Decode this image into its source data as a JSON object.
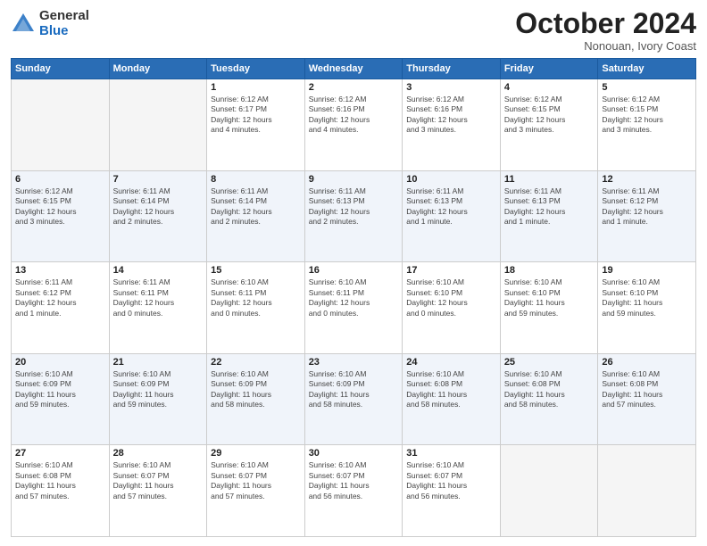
{
  "logo": {
    "general": "General",
    "blue": "Blue"
  },
  "title": "October 2024",
  "subtitle": "Nonouan, Ivory Coast",
  "days_of_week": [
    "Sunday",
    "Monday",
    "Tuesday",
    "Wednesday",
    "Thursday",
    "Friday",
    "Saturday"
  ],
  "weeks": [
    [
      {
        "day": "",
        "info": ""
      },
      {
        "day": "",
        "info": ""
      },
      {
        "day": "1",
        "info": "Sunrise: 6:12 AM\nSunset: 6:17 PM\nDaylight: 12 hours\nand 4 minutes."
      },
      {
        "day": "2",
        "info": "Sunrise: 6:12 AM\nSunset: 6:16 PM\nDaylight: 12 hours\nand 4 minutes."
      },
      {
        "day": "3",
        "info": "Sunrise: 6:12 AM\nSunset: 6:16 PM\nDaylight: 12 hours\nand 3 minutes."
      },
      {
        "day": "4",
        "info": "Sunrise: 6:12 AM\nSunset: 6:15 PM\nDaylight: 12 hours\nand 3 minutes."
      },
      {
        "day": "5",
        "info": "Sunrise: 6:12 AM\nSunset: 6:15 PM\nDaylight: 12 hours\nand 3 minutes."
      }
    ],
    [
      {
        "day": "6",
        "info": "Sunrise: 6:12 AM\nSunset: 6:15 PM\nDaylight: 12 hours\nand 3 minutes."
      },
      {
        "day": "7",
        "info": "Sunrise: 6:11 AM\nSunset: 6:14 PM\nDaylight: 12 hours\nand 2 minutes."
      },
      {
        "day": "8",
        "info": "Sunrise: 6:11 AM\nSunset: 6:14 PM\nDaylight: 12 hours\nand 2 minutes."
      },
      {
        "day": "9",
        "info": "Sunrise: 6:11 AM\nSunset: 6:13 PM\nDaylight: 12 hours\nand 2 minutes."
      },
      {
        "day": "10",
        "info": "Sunrise: 6:11 AM\nSunset: 6:13 PM\nDaylight: 12 hours\nand 1 minute."
      },
      {
        "day": "11",
        "info": "Sunrise: 6:11 AM\nSunset: 6:13 PM\nDaylight: 12 hours\nand 1 minute."
      },
      {
        "day": "12",
        "info": "Sunrise: 6:11 AM\nSunset: 6:12 PM\nDaylight: 12 hours\nand 1 minute."
      }
    ],
    [
      {
        "day": "13",
        "info": "Sunrise: 6:11 AM\nSunset: 6:12 PM\nDaylight: 12 hours\nand 1 minute."
      },
      {
        "day": "14",
        "info": "Sunrise: 6:11 AM\nSunset: 6:11 PM\nDaylight: 12 hours\nand 0 minutes."
      },
      {
        "day": "15",
        "info": "Sunrise: 6:10 AM\nSunset: 6:11 PM\nDaylight: 12 hours\nand 0 minutes."
      },
      {
        "day": "16",
        "info": "Sunrise: 6:10 AM\nSunset: 6:11 PM\nDaylight: 12 hours\nand 0 minutes."
      },
      {
        "day": "17",
        "info": "Sunrise: 6:10 AM\nSunset: 6:10 PM\nDaylight: 12 hours\nand 0 minutes."
      },
      {
        "day": "18",
        "info": "Sunrise: 6:10 AM\nSunset: 6:10 PM\nDaylight: 11 hours\nand 59 minutes."
      },
      {
        "day": "19",
        "info": "Sunrise: 6:10 AM\nSunset: 6:10 PM\nDaylight: 11 hours\nand 59 minutes."
      }
    ],
    [
      {
        "day": "20",
        "info": "Sunrise: 6:10 AM\nSunset: 6:09 PM\nDaylight: 11 hours\nand 59 minutes."
      },
      {
        "day": "21",
        "info": "Sunrise: 6:10 AM\nSunset: 6:09 PM\nDaylight: 11 hours\nand 59 minutes."
      },
      {
        "day": "22",
        "info": "Sunrise: 6:10 AM\nSunset: 6:09 PM\nDaylight: 11 hours\nand 58 minutes."
      },
      {
        "day": "23",
        "info": "Sunrise: 6:10 AM\nSunset: 6:09 PM\nDaylight: 11 hours\nand 58 minutes."
      },
      {
        "day": "24",
        "info": "Sunrise: 6:10 AM\nSunset: 6:08 PM\nDaylight: 11 hours\nand 58 minutes."
      },
      {
        "day": "25",
        "info": "Sunrise: 6:10 AM\nSunset: 6:08 PM\nDaylight: 11 hours\nand 58 minutes."
      },
      {
        "day": "26",
        "info": "Sunrise: 6:10 AM\nSunset: 6:08 PM\nDaylight: 11 hours\nand 57 minutes."
      }
    ],
    [
      {
        "day": "27",
        "info": "Sunrise: 6:10 AM\nSunset: 6:08 PM\nDaylight: 11 hours\nand 57 minutes."
      },
      {
        "day": "28",
        "info": "Sunrise: 6:10 AM\nSunset: 6:07 PM\nDaylight: 11 hours\nand 57 minutes."
      },
      {
        "day": "29",
        "info": "Sunrise: 6:10 AM\nSunset: 6:07 PM\nDaylight: 11 hours\nand 57 minutes."
      },
      {
        "day": "30",
        "info": "Sunrise: 6:10 AM\nSunset: 6:07 PM\nDaylight: 11 hours\nand 56 minutes."
      },
      {
        "day": "31",
        "info": "Sunrise: 6:10 AM\nSunset: 6:07 PM\nDaylight: 11 hours\nand 56 minutes."
      },
      {
        "day": "",
        "info": ""
      },
      {
        "day": "",
        "info": ""
      }
    ]
  ]
}
